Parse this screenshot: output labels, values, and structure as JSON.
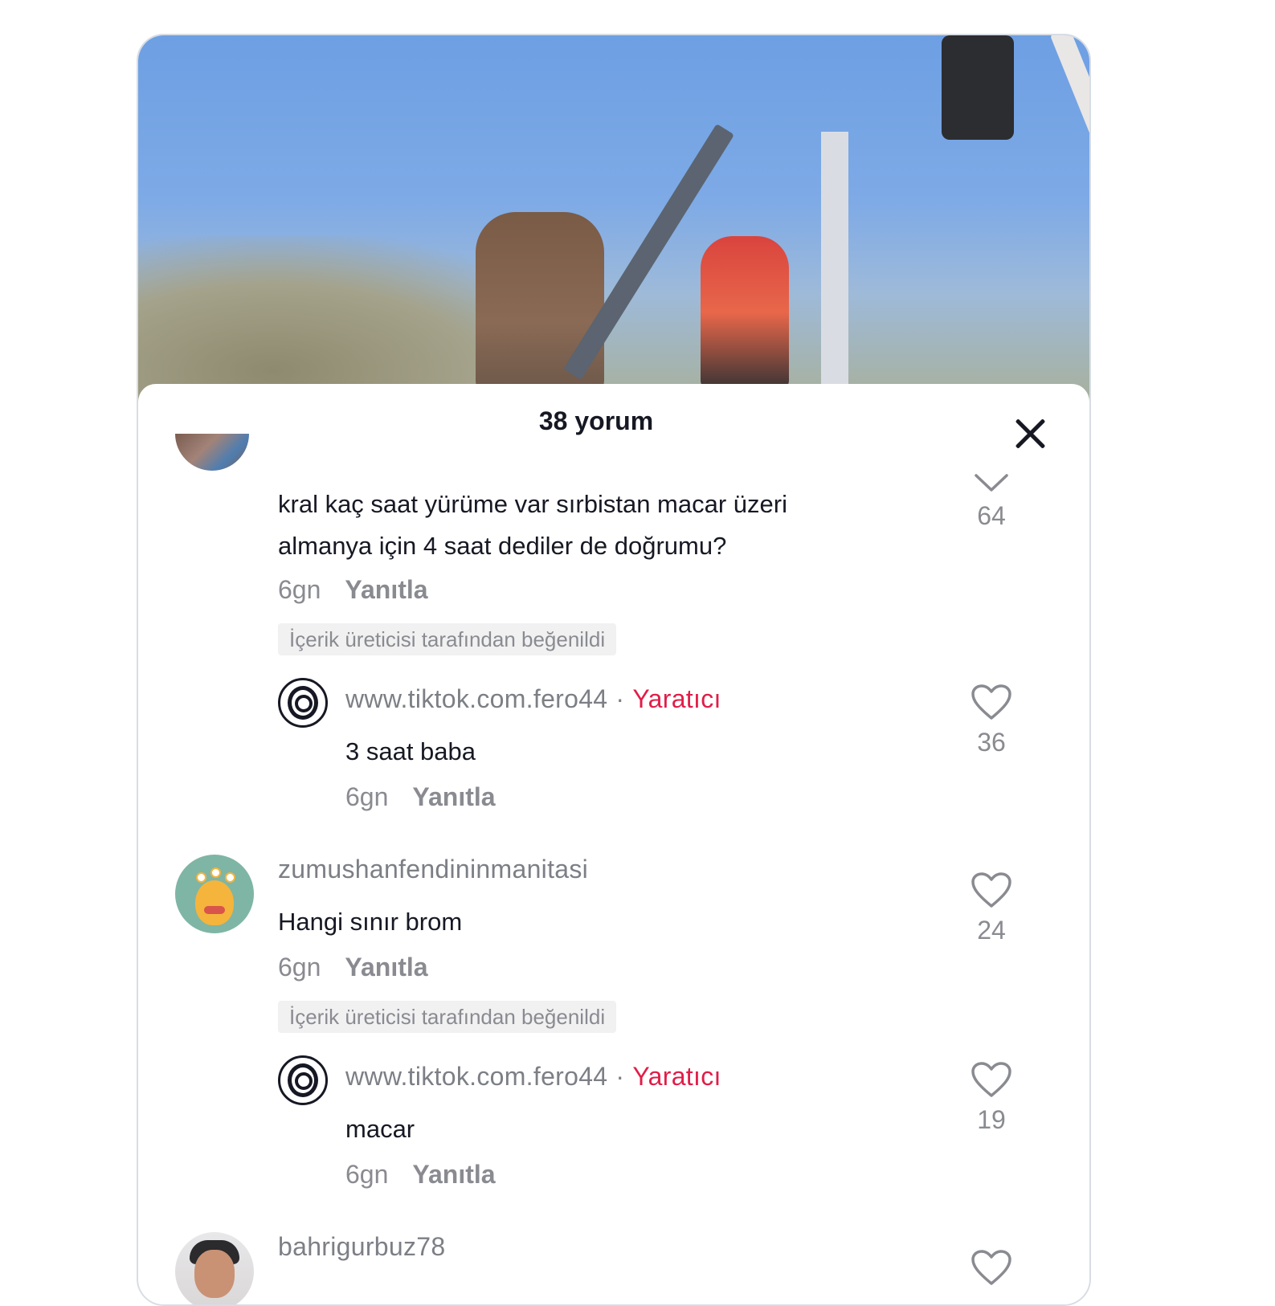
{
  "sheet": {
    "title": "38 yorum"
  },
  "comments": [
    {
      "username": "",
      "text": "kral kaç saat yürüme var sırbistan macar üzeri almanya için 4 saat dediler de doğrumu?",
      "time": "6gn",
      "reply_label": "Yanıtla",
      "liked_badge": "İçerik üreticisi tarafından beğenildi",
      "likes": "64",
      "reply": {
        "username": "www.tiktok.com.fero44",
        "separator": "·",
        "creator_label": "Yaratıcı",
        "text": "3 saat baba",
        "time": "6gn",
        "reply_label": "Yanıtla",
        "likes": "36"
      }
    },
    {
      "username": "zumushanfendininmanitasi",
      "text": "Hangi sınır brom",
      "time": "6gn",
      "reply_label": "Yanıtla",
      "liked_badge": "İçerik üreticisi tarafından beğenildi",
      "likes": "24",
      "reply": {
        "username": "www.tiktok.com.fero44",
        "separator": "·",
        "creator_label": "Yaratıcı",
        "text": "macar",
        "time": "6gn",
        "reply_label": "Yanıtla",
        "likes": "19"
      }
    },
    {
      "username": "bahrigurbuz78"
    }
  ],
  "colors": {
    "creator_accent": "#e11d48",
    "muted_text": "#8a8b91"
  }
}
